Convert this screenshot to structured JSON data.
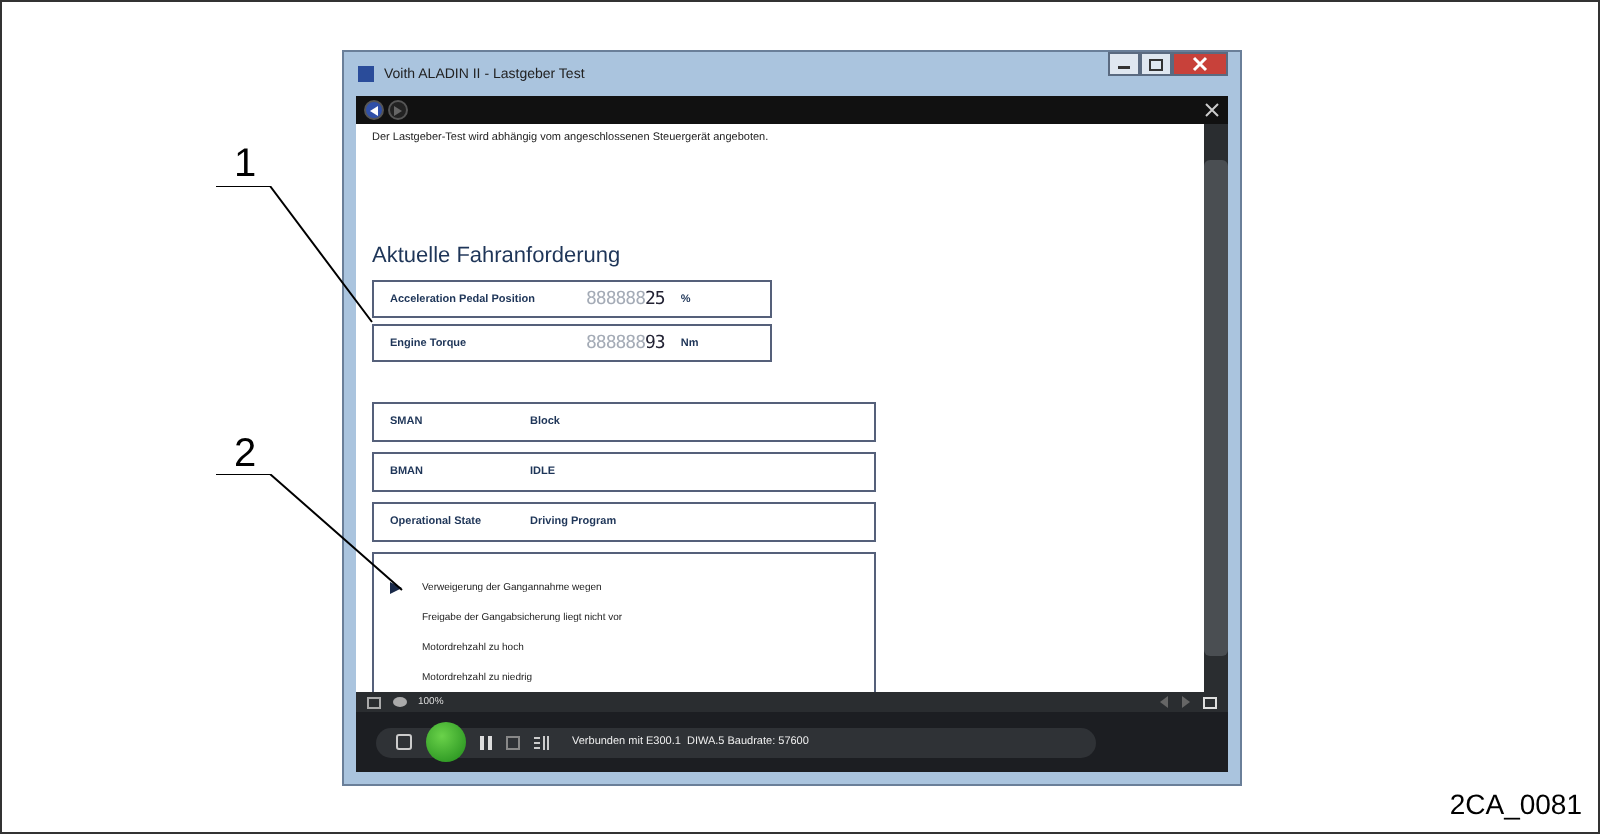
{
  "window": {
    "title": "Voith ALADIN II - Lastgeber Test"
  },
  "intro": "Der Lastgeber-Test wird abhängig vom angeschlossenen Steuergerät angeboten.",
  "heading": "Aktuelle Fahranforderung",
  "readings": [
    {
      "label": "Acceleration Pedal Position",
      "ghost": "888888",
      "value": "25",
      "unit": "%"
    },
    {
      "label": "Engine Torque",
      "ghost": "888888",
      "value": "93",
      "unit": "Nm"
    }
  ],
  "states": [
    {
      "label": "SMAN",
      "value": "Block"
    },
    {
      "label": "BMAN",
      "value": "IDLE"
    },
    {
      "label": "Operational State",
      "value": "Driving Program"
    }
  ],
  "messages": [
    {
      "text": "Verweigerung der Gangannahme wegen",
      "selected": true
    },
    {
      "text": "Freigabe der Gangabsicherung liegt nicht vor",
      "selected": false
    },
    {
      "text": "Motordrehzahl zu hoch",
      "selected": false
    },
    {
      "text": "Motordrehzahl zu niedrig",
      "selected": false
    }
  ],
  "zoom": "100%",
  "status_bar": {
    "connection": "Verbunden mit E300.1  DIWA.5 Baudrate: 57600"
  },
  "callouts": [
    {
      "number": "1"
    },
    {
      "number": "2"
    }
  ],
  "figure_id": "2CA_0081"
}
